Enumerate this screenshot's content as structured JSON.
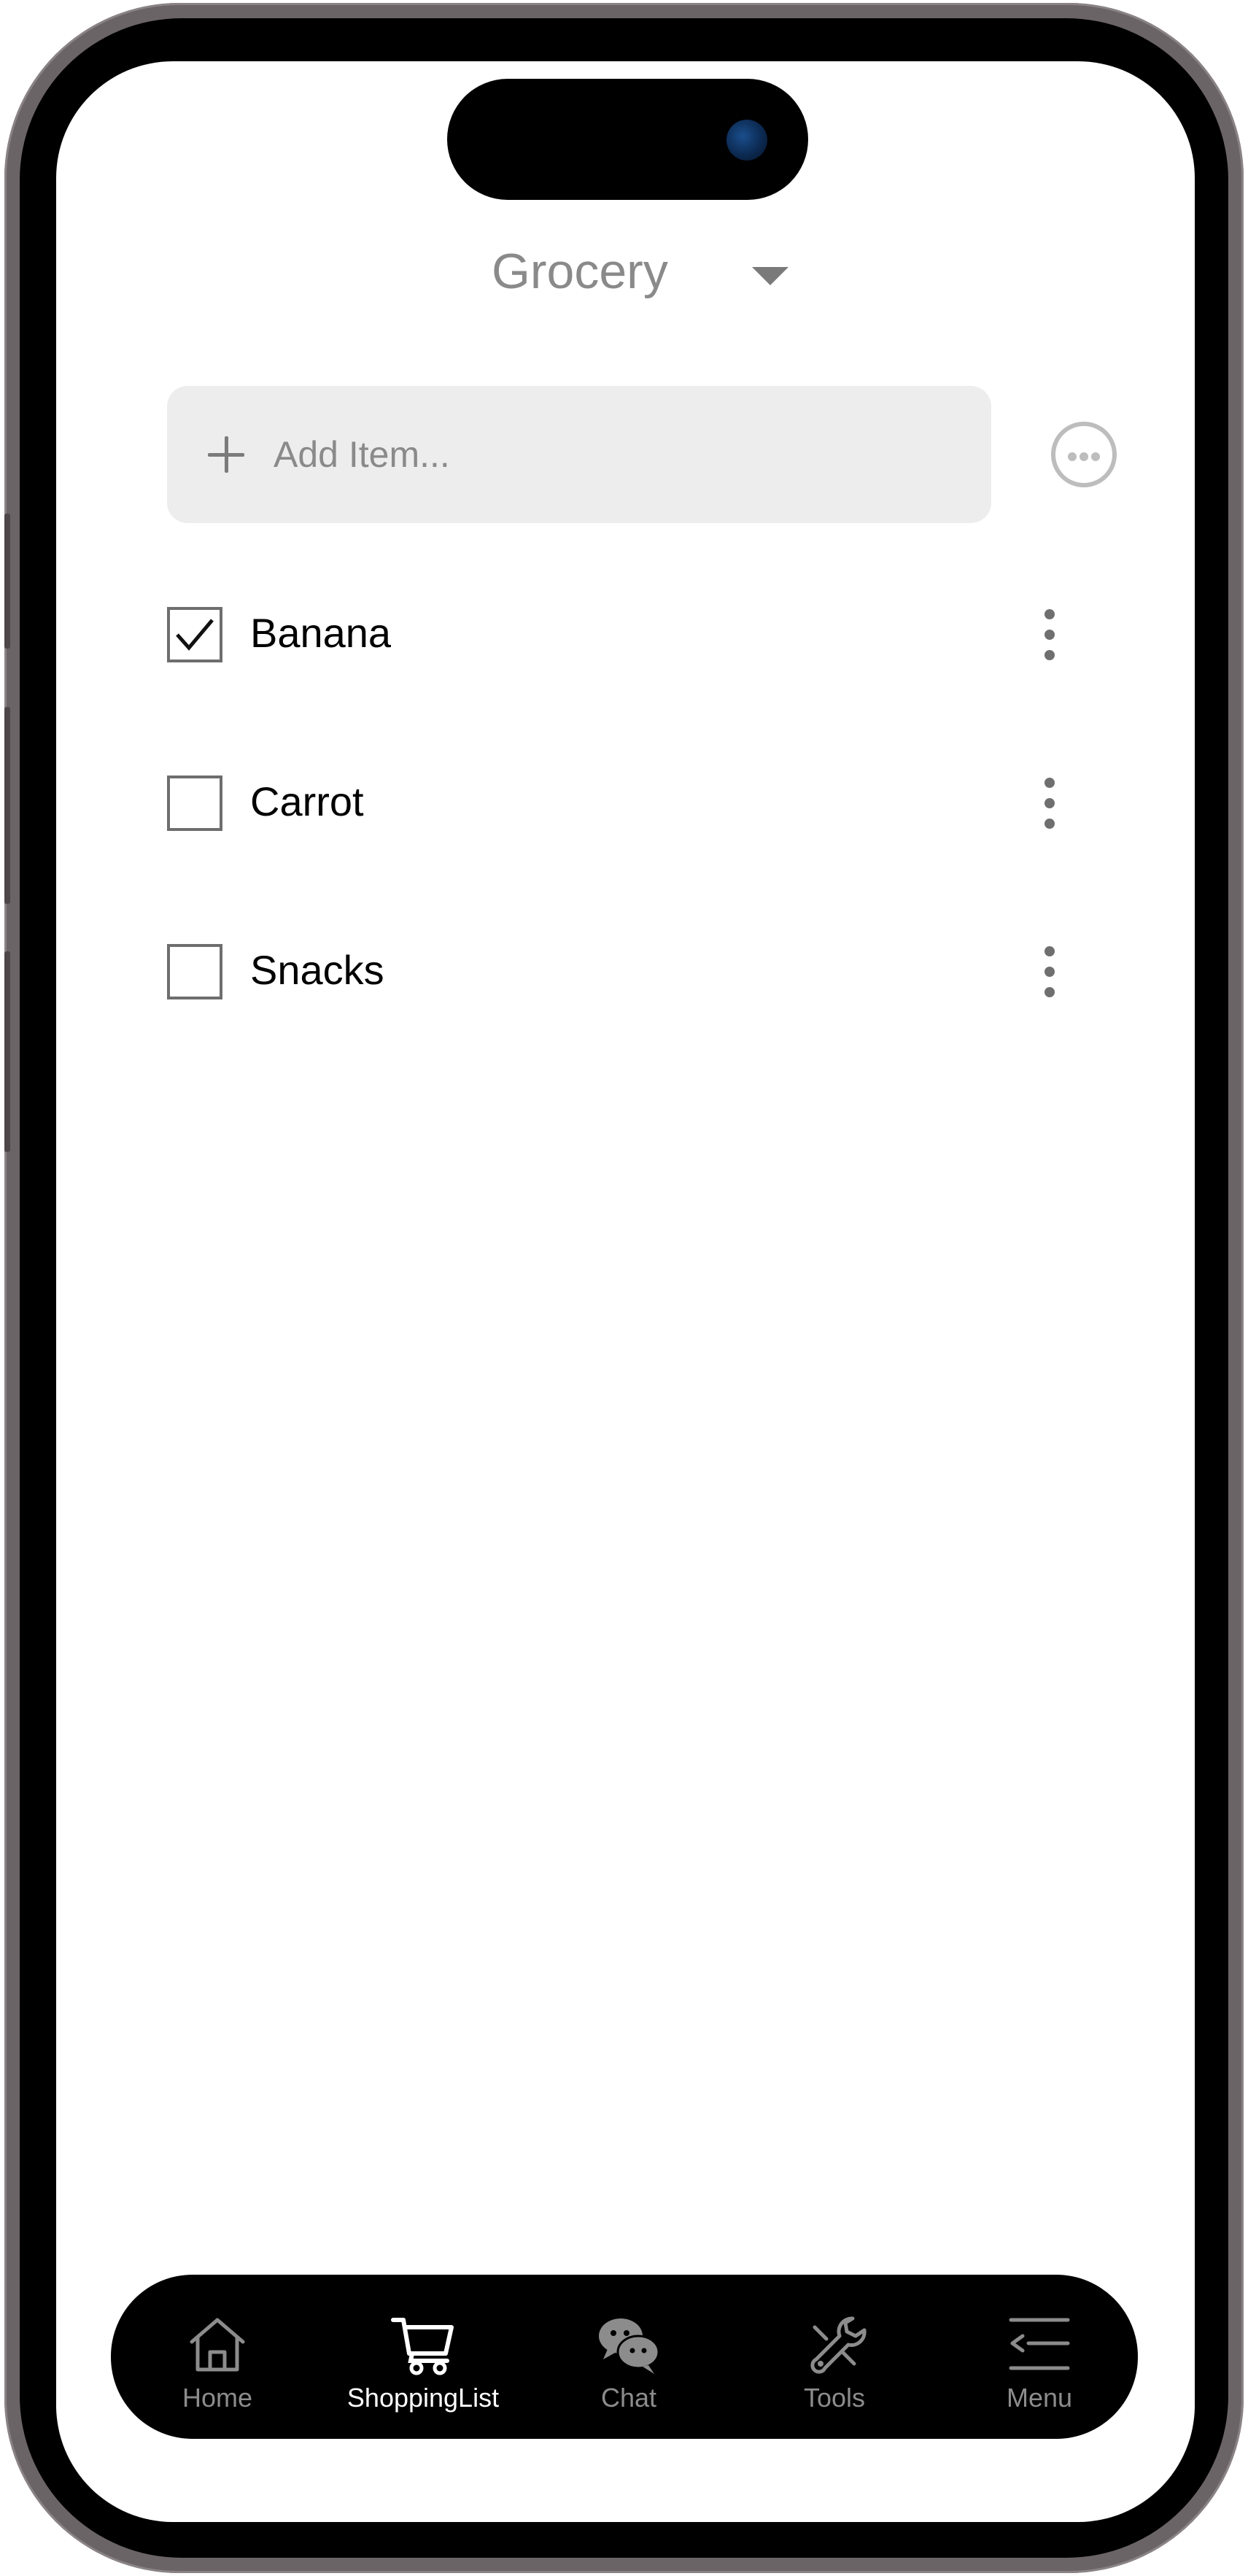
{
  "header": {
    "list_title": "Grocery",
    "dropdown_icon": "caret-down-icon"
  },
  "add_item": {
    "placeholder": "Add Item...",
    "value": "",
    "add_icon": "plus-icon",
    "more_icon": "more-options-icon"
  },
  "items": [
    {
      "label": "Banana",
      "checked": true
    },
    {
      "label": "Carrot",
      "checked": false
    },
    {
      "label": "Snacks",
      "checked": false
    }
  ],
  "bottom_nav": {
    "items": [
      {
        "label": "Home",
        "icon": "home-icon",
        "active": false
      },
      {
        "label": "ShoppingList",
        "icon": "cart-icon",
        "active": true
      },
      {
        "label": "Chat",
        "icon": "chat-icon",
        "active": false
      },
      {
        "label": "Tools",
        "icon": "wrench-icon",
        "active": false
      },
      {
        "label": "Menu",
        "icon": "menu-icon",
        "active": false
      }
    ]
  },
  "colors": {
    "accent_active": "#ffffff",
    "inactive": "#8c8c8c",
    "field_bg": "#ededed",
    "nav_bg": "#000000"
  }
}
